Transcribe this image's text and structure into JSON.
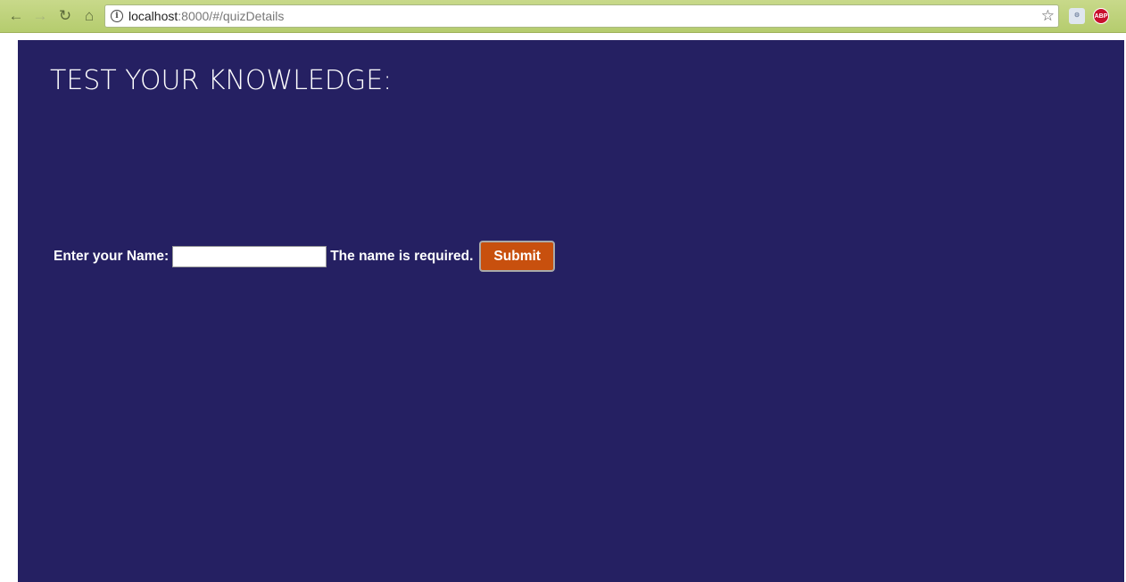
{
  "browser": {
    "url_host": "localhost",
    "url_rest": ":8000/#/quizDetails",
    "icons": {
      "back": "arrow-left-icon",
      "forward": "arrow-right-icon",
      "reload": "reload-icon",
      "home": "home-icon",
      "info": "info-icon",
      "bookmark": "star-icon",
      "extension": "extension-icon",
      "adblock": "abp-icon"
    },
    "adblock_label": "ABP"
  },
  "page": {
    "title": "TEST YOUR KNOWLEDGE:",
    "form": {
      "name_label": "Enter your Name:",
      "name_value": "",
      "error_text": "The name is required.",
      "submit_label": "Submit"
    }
  },
  "colors": {
    "page_background": "#252062",
    "submit_button": "#c8500e",
    "browser_chrome": "#b5cc6e"
  }
}
